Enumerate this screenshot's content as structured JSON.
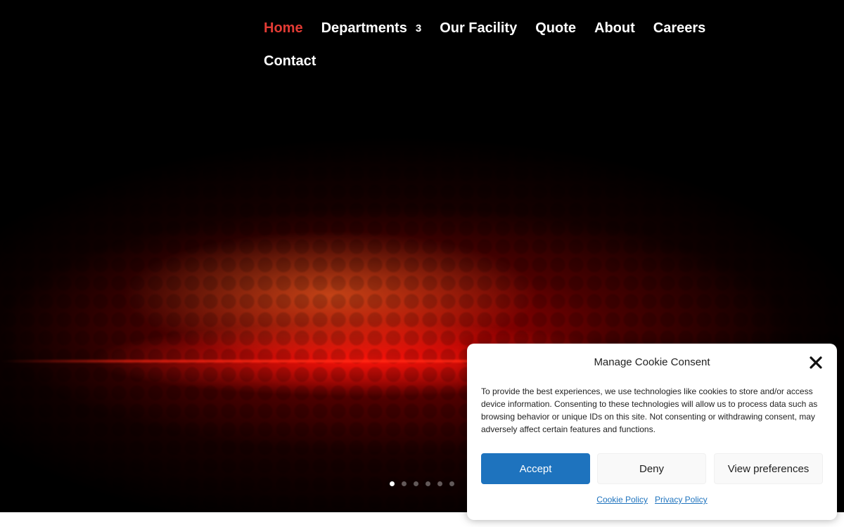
{
  "nav": {
    "items": [
      {
        "label": "Home",
        "active": true
      },
      {
        "label": "Departments",
        "badge": "3"
      },
      {
        "label": "Our Facility"
      },
      {
        "label": "Quote"
      },
      {
        "label": "About"
      },
      {
        "label": "Careers"
      },
      {
        "label": "Contact"
      }
    ]
  },
  "slider": {
    "dot_count": 6,
    "active_index": 0
  },
  "cookie": {
    "title": "Manage Cookie Consent",
    "body": "To provide the best experiences, we use technologies like cookies to store and/or access device information. Consenting to these technologies will allow us to process data such as browsing behavior or unique IDs on this site. Not consenting or withdrawing consent, may adversely affect certain features and functions.",
    "accept_label": "Accept",
    "deny_label": "Deny",
    "preferences_label": "View preferences",
    "cookie_policy_link": "Cookie Policy",
    "privacy_policy_link": "Privacy Policy",
    "close_icon": "close-icon"
  },
  "colors": {
    "active_nav": "#e23b34",
    "accept_button": "#1e73be",
    "link": "#1e73be"
  }
}
